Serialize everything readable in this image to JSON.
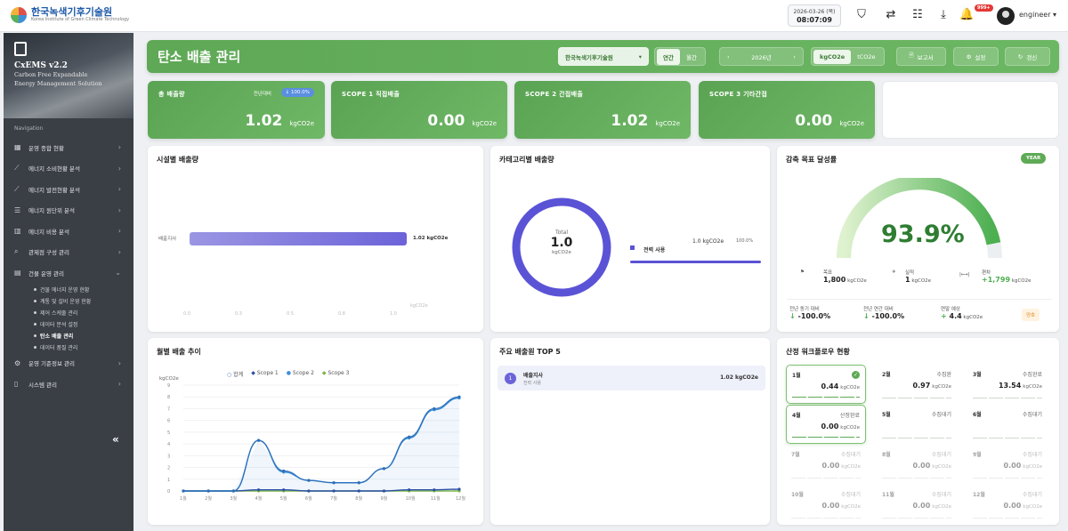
{
  "topbar": {
    "logo_title": "한국녹색기후기술원",
    "logo_sub": "Korea Institute of Green Climate Technology",
    "date": "2026-03-26 (목)",
    "time": "08:07:09",
    "notif_badge": "999+",
    "user": "engineer",
    "icons": [
      "shield-icon",
      "swap-icon",
      "list-icon",
      "download-icon",
      "bell-icon"
    ]
  },
  "sidebar": {
    "version": "CxEMS v2.2",
    "desc1": "Carbon Free Expandable",
    "desc2": "Energy Management Solution",
    "nav_title": "Navigation",
    "items": [
      {
        "label": "운영 종합 현황",
        "icon": "dashboard-icon"
      },
      {
        "label": "에너지 소비현황 분석",
        "icon": "chart-line-icon"
      },
      {
        "label": "에너지 발전현황 분석",
        "icon": "chart-line-icon"
      },
      {
        "label": "에너지 원단위 분석",
        "icon": "list-icon"
      },
      {
        "label": "에너지 비용 분석",
        "icon": "table-icon"
      },
      {
        "label": "관제점 구성 관리",
        "icon": "search-icon"
      },
      {
        "label": "건물 운영 관리",
        "icon": "building-icon"
      }
    ],
    "sub_items": [
      "건물 에너지 운영 현황",
      "계통 및 설비 운영 현황",
      "제어 스케줄 관리",
      "데이터 분석 설정",
      "탄소 배출 관리",
      "데이터 품질 관리"
    ],
    "bottom_items": [
      {
        "label": "운영 기준정보 관리",
        "icon": "gear-icon"
      },
      {
        "label": "시스템 관리",
        "icon": "document-icon"
      }
    ],
    "collapse": "«"
  },
  "header": {
    "title": "탄소 배출 관리",
    "org_select": "한국녹색기후기술원",
    "period_tabs": [
      "연간",
      "월간"
    ],
    "year": "2026년",
    "unit_tabs": [
      "kgCO2e",
      "tCO2e"
    ],
    "report_btn": "보고서",
    "settings_btn": "설정",
    "refresh_btn": "갱신"
  },
  "kpis": [
    {
      "label": "총 배출량",
      "value": "1.02",
      "unit": "kgCO2e",
      "badge_label": "전년대비",
      "badge": "↓ 100.0%"
    },
    {
      "label": "SCOPE 1 직접배출",
      "value": "0.00",
      "unit": "kgCO2e"
    },
    {
      "label": "SCOPE 2 간접배출",
      "value": "1.02",
      "unit": "kgCO2e"
    },
    {
      "label": "SCOPE 3 기타간접",
      "value": "0.00",
      "unit": "kgCO2e"
    }
  ],
  "facility": {
    "title": "시설별 배출량",
    "bar_label": "배출지사",
    "bar_value": "1.02 kgCO2e",
    "ticks": [
      "0.0",
      "0.3",
      "0.5",
      "0.8",
      "1.0"
    ],
    "axis_unit": "kgCO2e"
  },
  "category": {
    "title": "카테고리별 배출량",
    "donut_label": "Total",
    "donut_value": "1.0",
    "donut_unit": "kgCO2e",
    "legend_name": "전력 사용",
    "legend_value": "1.0 kgCO2e",
    "legend_pct": "100.0%"
  },
  "goal": {
    "title": "감축 목표 달성률",
    "year_pill": "YEAR",
    "percent": "93.9%",
    "target_label": "목표",
    "target_value": "1,800",
    "target_unit": "kgCO2e",
    "actual_label": "실적",
    "actual_value": "1",
    "actual_unit": "kgCO2e",
    "diff_label": "편차",
    "diff_value": "+1,799",
    "diff_unit": "kgCO2e",
    "yoy_label": "전년 동기 대비",
    "yoy_value": "-100.0%",
    "prev_label": "전년 연간 대비",
    "prev_value": "-100.0%",
    "forecast_label": "연말 예상",
    "forecast_value": "4.4",
    "forecast_unit": "kgCO2e",
    "status": "양호"
  },
  "monthly": {
    "title": "월별 배출 추이",
    "ylabel": "kgCO2e",
    "legend": [
      "합계",
      "Scope 1",
      "Scope 2",
      "Scope 3"
    ]
  },
  "chart_data": {
    "type": "line",
    "categories": [
      "1월",
      "2월",
      "3월",
      "4월",
      "5월",
      "6월",
      "7월",
      "8월",
      "9월",
      "10월",
      "11월",
      "12월"
    ],
    "ylabel": "kgCO2e",
    "ylim": [
      0,
      9
    ],
    "yticks": [
      "0",
      "1",
      "2",
      "3",
      "4",
      "5",
      "6",
      "7",
      "8",
      "9"
    ],
    "series": [
      {
        "name": "합계",
        "values": [
          0,
          0,
          0,
          4.3,
          1.7,
          0.9,
          0.7,
          0.7,
          1.9,
          4.6,
          7.0,
          8.0
        ],
        "color": "#2d6fb8"
      },
      {
        "name": "Scope 1",
        "values": [
          0,
          0,
          0,
          0.1,
          0.1,
          0,
          0,
          0,
          0,
          0.1,
          0.1,
          0.15
        ],
        "color": "#2d4fa8"
      },
      {
        "name": "Scope 2",
        "values": [
          0,
          0,
          0,
          4.3,
          1.6,
          0.9,
          0.7,
          0.7,
          1.9,
          4.5,
          6.9,
          7.9
        ],
        "color": "#3c8ed8"
      },
      {
        "name": "Scope 3",
        "values": [
          0,
          0,
          0,
          0,
          0,
          0,
          0,
          0,
          0,
          0,
          0,
          0
        ],
        "color": "#7ab648"
      }
    ]
  },
  "top5": {
    "title": "주요 배출원 TOP 5",
    "rank": "1",
    "name": "배출지사",
    "sub": "전력 사용",
    "value": "1.02 kgCO2e"
  },
  "workflow": {
    "title": "산정 워크플로우 현황",
    "items": [
      {
        "month": "1월",
        "status": "",
        "value": "0.44",
        "unit": "kgCO2e",
        "active": true,
        "check": true
      },
      {
        "month": "2월",
        "status": "수집완",
        "value": "0.97",
        "unit": "kgCO2e"
      },
      {
        "month": "3월",
        "status": "수집완료",
        "value": "13.54",
        "unit": "kgCO2e"
      },
      {
        "month": "4월",
        "status": "산정완료",
        "value": "0.00",
        "unit": "kgCO2e",
        "active": true
      },
      {
        "month": "5월",
        "status": "수집대기",
        "value": "",
        "unit": ""
      },
      {
        "month": "6월",
        "status": "수집대기",
        "value": "",
        "unit": ""
      },
      {
        "month": "7월",
        "status": "수집대기",
        "value": "0.00",
        "unit": "kgCO2e",
        "faded": true
      },
      {
        "month": "8월",
        "status": "수집대기",
        "value": "0.00",
        "unit": "kgCO2e",
        "faded": true
      },
      {
        "month": "9월",
        "status": "수집대기",
        "value": "0.00",
        "unit": "kgCO2e",
        "faded": true
      },
      {
        "month": "10월",
        "status": "수집대기",
        "value": "0.00",
        "unit": "kgCO2e",
        "faded": true
      },
      {
        "month": "11월",
        "status": "수집대기",
        "value": "0.00",
        "unit": "kgCO2e",
        "faded": true
      },
      {
        "month": "12월",
        "status": "수집대기",
        "value": "0.00",
        "unit": "kgCO2e",
        "faded": true
      }
    ]
  }
}
